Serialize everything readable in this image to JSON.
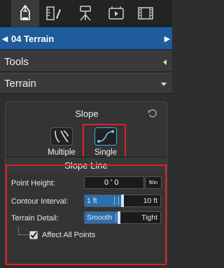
{
  "modebar": {
    "tabs": [
      {
        "icon": "pencil-icon",
        "active": true
      },
      {
        "icon": "ruler-pencil-icon",
        "active": false
      },
      {
        "icon": "tripod-icon",
        "active": false
      },
      {
        "icon": "video-icon",
        "active": false
      },
      {
        "icon": "film-strip-icon",
        "active": false
      }
    ]
  },
  "filebar": {
    "title": "04 Terrain"
  },
  "sections": {
    "tools": "Tools",
    "terrain": "Terrain"
  },
  "slope": {
    "title": "Slope",
    "multiple_label": "Multiple",
    "single_label": "Single",
    "selected": "Single"
  },
  "slope_line": {
    "title": "Slope Line",
    "point_height_label": "Point Height:",
    "point_height_value": "0 ' 0",
    "point_height_unit": "ft/in",
    "contour_interval_label": "Contour Interval:",
    "contour_min": "1 ft",
    "contour_max": "10 ft",
    "contour_fraction": 0.5,
    "terrain_detail_label": "Terrain Detail:",
    "detail_min": "Smooth",
    "detail_max": "Tight",
    "detail_fraction": 0.45,
    "affect_all_label": "Affect All Points",
    "affect_all_checked": true
  },
  "colors": {
    "accent": "#1f5c9b",
    "highlight": "#e0201f",
    "slider": "#2b6fae"
  }
}
